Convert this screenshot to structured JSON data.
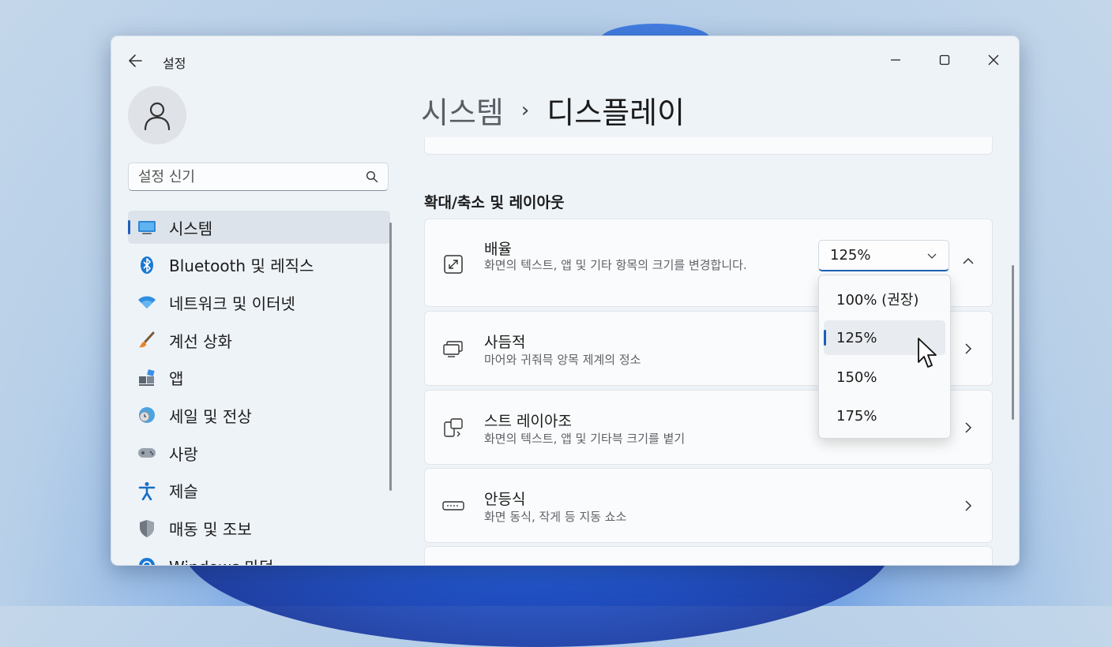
{
  "window": {
    "title": "설정",
    "controls": {
      "minimize": "minimize",
      "maximize": "maximize",
      "close": "close"
    }
  },
  "search": {
    "placeholder": "설정 신기"
  },
  "sidebar": {
    "items": [
      {
        "label": "시스템",
        "icon": "monitor-icon",
        "active": true
      },
      {
        "label": "Bluetooth 및 레직스",
        "icon": "bluetooth-icon"
      },
      {
        "label": "네트워크 및 이터넷",
        "icon": "wifi-icon"
      },
      {
        "label": "계선 상화",
        "icon": "brush-icon"
      },
      {
        "label": "앱",
        "icon": "apps-icon"
      },
      {
        "label": "세일 및 전상",
        "icon": "globe-clock-icon"
      },
      {
        "label": "사랑",
        "icon": "gamepad-icon"
      },
      {
        "label": "제슬",
        "icon": "accessibility-icon"
      },
      {
        "label": "매동 및 조보",
        "icon": "shield-icon"
      },
      {
        "label": "Windows 마덕",
        "icon": "update-icon"
      }
    ]
  },
  "breadcrumb": {
    "parent": "시스템",
    "separator": "›",
    "current": "디스플레이"
  },
  "section": {
    "title": "확대/축소 및 레이아웃"
  },
  "settings": [
    {
      "title": "배율",
      "description": "화면의 텍스트, 앱 및 기타 항목의 크기를 변경합니다."
    },
    {
      "title": "사듬적",
      "description": "마어와 귀줘믁 앙목 제계의 정소"
    },
    {
      "title": "스트 레이아조",
      "description": "화면의 텍스트, 앱 및 기타븍 크기를 볕기"
    },
    {
      "title": "안등식",
      "description": "화면 동식, 작게 등 지동 쇼소"
    }
  ],
  "scale": {
    "current": "125%",
    "options": [
      "100% (권장)",
      "125%",
      "150%",
      "175%"
    ],
    "selected_index": 1
  },
  "colors": {
    "accent": "#1d5fb8",
    "window_bg": "#eef3f8",
    "card_bg": "#fafbfc"
  }
}
